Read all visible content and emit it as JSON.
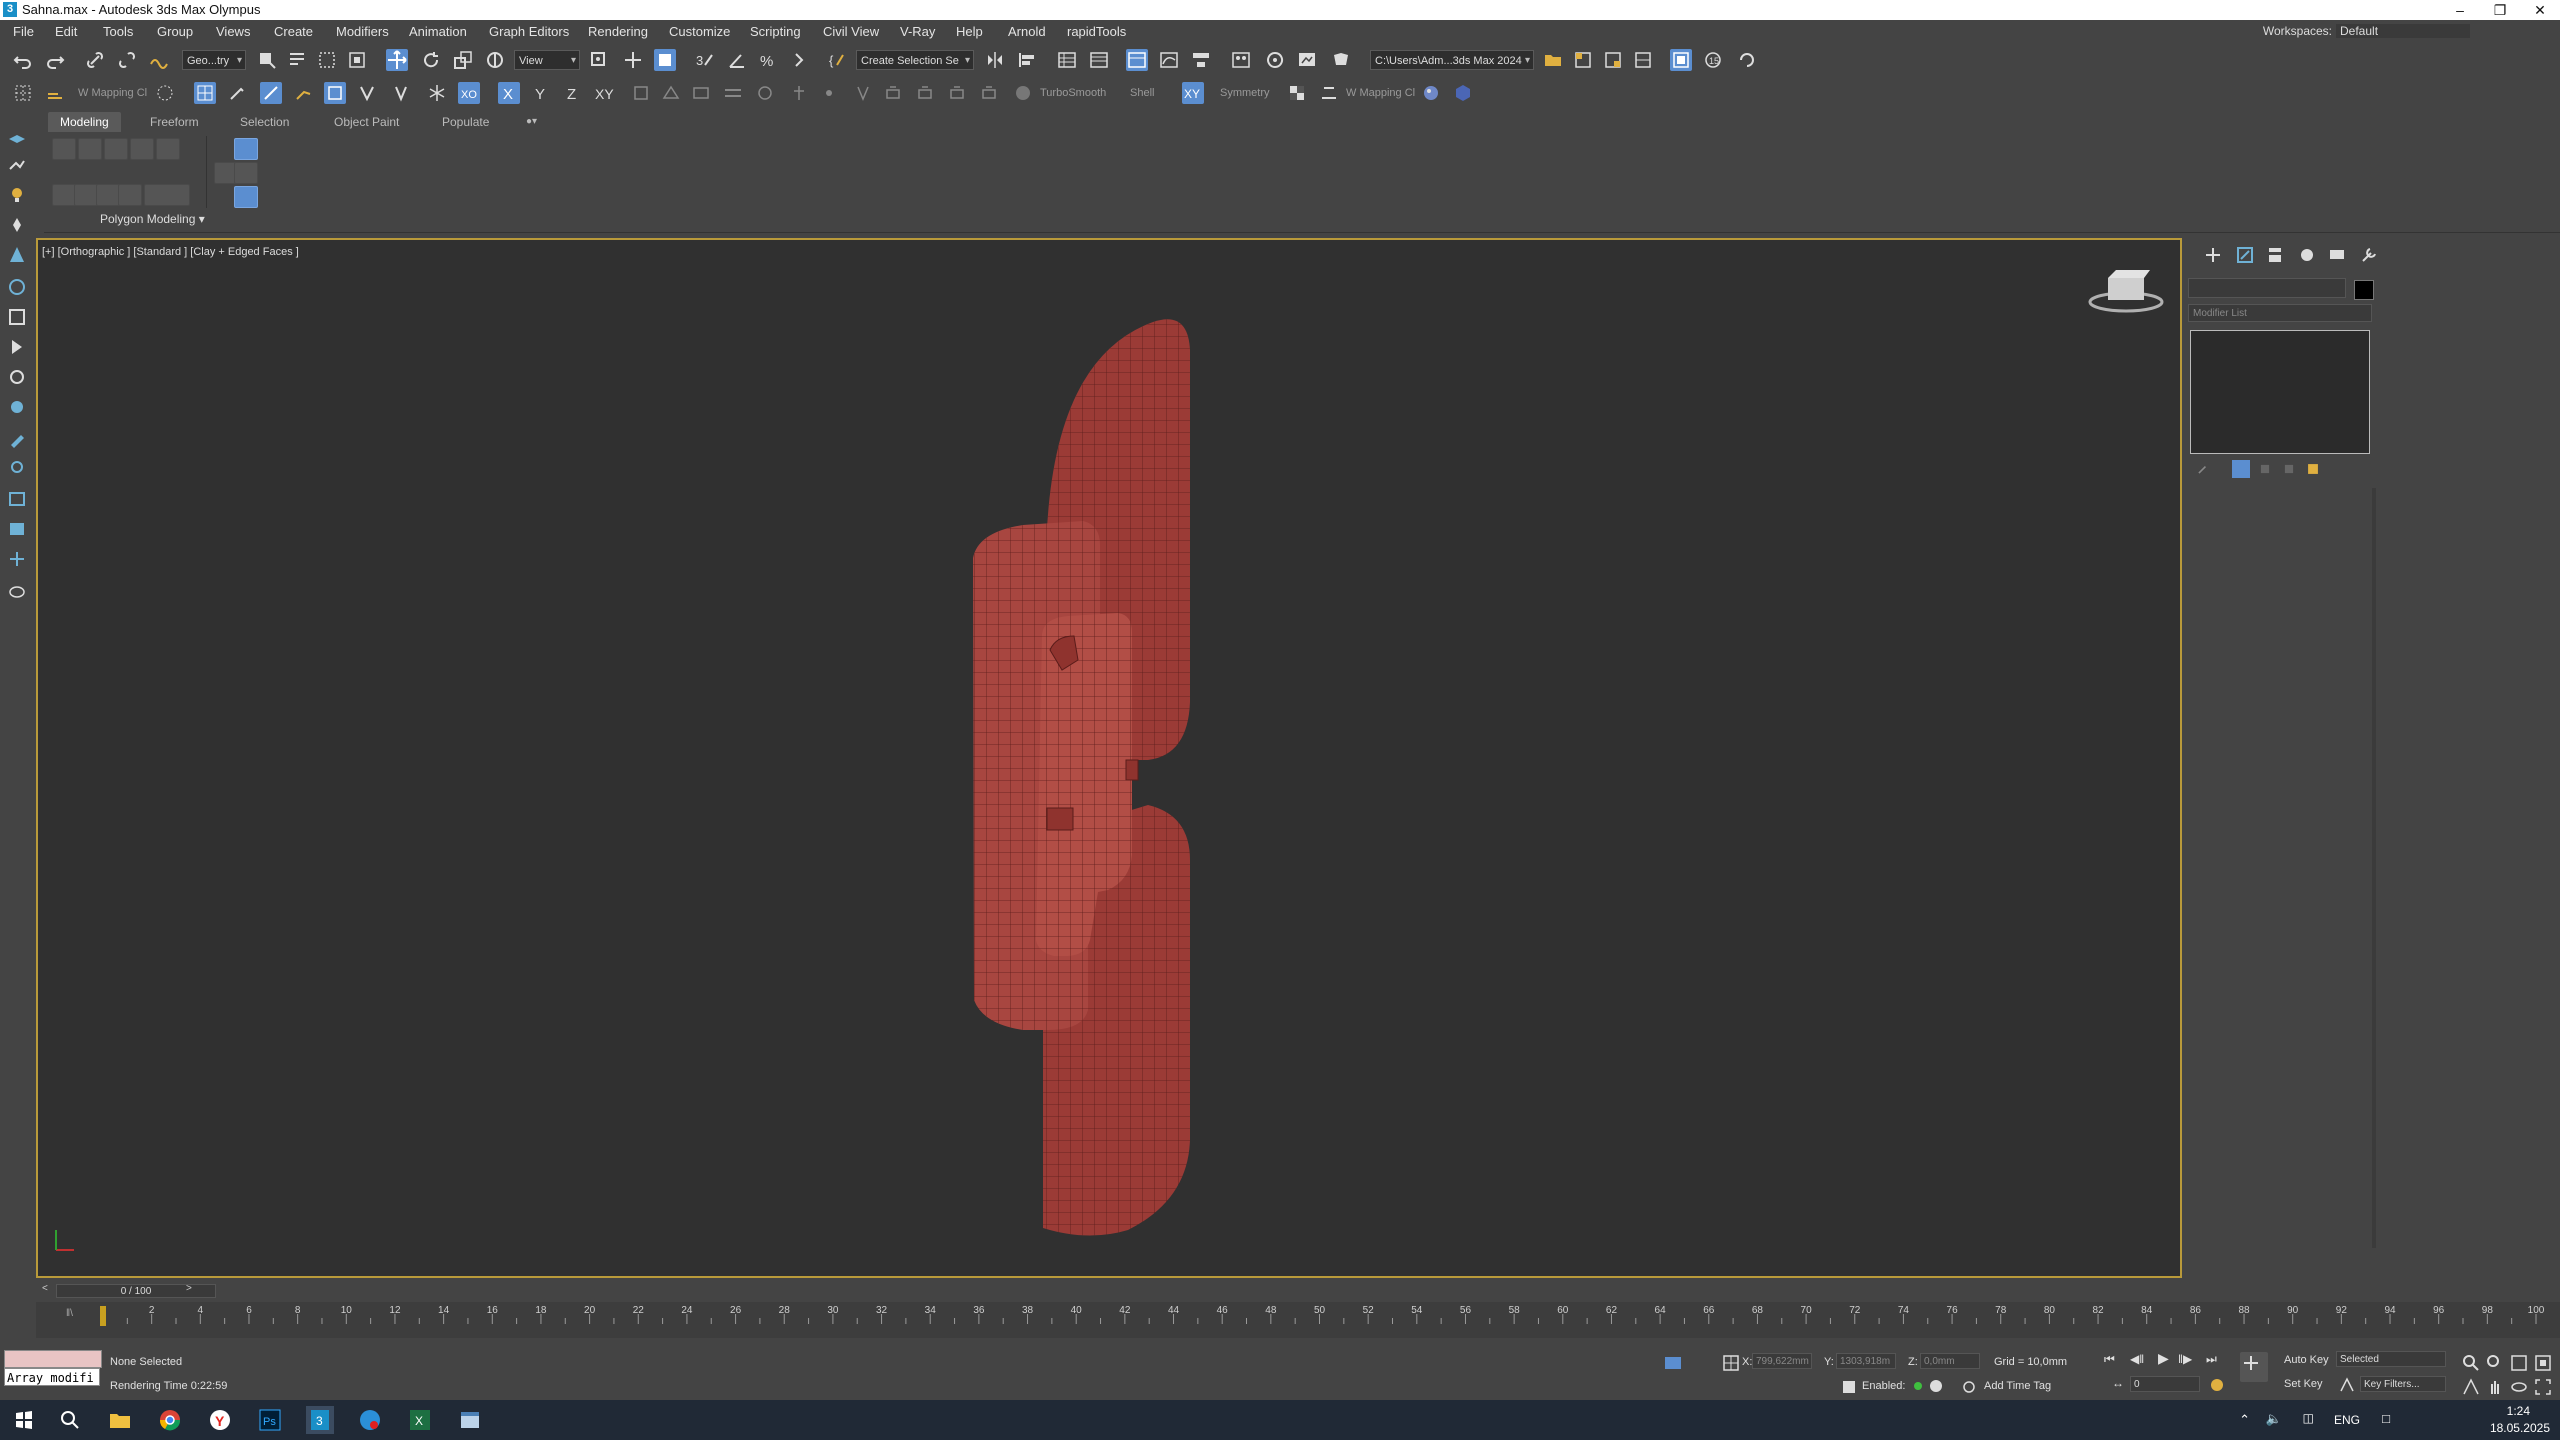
{
  "window": {
    "title": "Sahna.max - Autodesk 3ds Max Olympus",
    "controls": [
      "minimize",
      "restore",
      "close"
    ]
  },
  "menubar": {
    "items": [
      "File",
      "Edit",
      "Tools",
      "Group",
      "Views",
      "Create",
      "Modifiers",
      "Animation",
      "Graph Editors",
      "Rendering",
      "Customize",
      "Scripting",
      "Civil View",
      "V-Ray",
      "Help",
      "Arnold",
      "rapidTools"
    ],
    "workspace_label": "Workspaces:",
    "workspace_value": "Default"
  },
  "toolbar1": {
    "selection_filter": "Geo...try",
    "ref_coord": "View",
    "named_selection": "Create Selection Se",
    "project_path": "C:\\Users\\Adm...3ds Max 2024"
  },
  "toolbar2": {
    "uv_mapping_1": "W Mapping Cl",
    "turbosmooth": "TurboSmooth",
    "shell": "Shell",
    "xyz": [
      "X",
      "Y",
      "Z",
      "XY"
    ],
    "symmetry": "Symmetry",
    "uv_mapping_2": "W Mapping Cl"
  },
  "ribbon": {
    "tabs": [
      "Modeling",
      "Freeform",
      "Selection",
      "Object Paint",
      "Populate"
    ],
    "active_tab": "Modeling",
    "panel_label": "Polygon Modeling"
  },
  "viewport": {
    "label": "[+] [Orthographic ] [Standard ] [Clay + Edged Faces ]",
    "model_color": "#9b3b36",
    "wire_color": "#5a1c1a",
    "border_color": "#b99a3a"
  },
  "command_panel": {
    "modifier_list": "Modifier List"
  },
  "timeline": {
    "slider": "0 / 100",
    "tick_labels": [
      "0",
      "2",
      "4",
      "6",
      "8",
      "10",
      "12",
      "14",
      "16",
      "18",
      "20",
      "22",
      "24",
      "26",
      "28",
      "30",
      "32",
      "34",
      "36",
      "38",
      "40",
      "42",
      "44",
      "46",
      "48",
      "50",
      "52",
      "54",
      "56",
      "58",
      "60",
      "62",
      "64",
      "66",
      "68",
      "70",
      "72",
      "74",
      "76",
      "78",
      "80",
      "82",
      "84",
      "86",
      "88",
      "90",
      "92",
      "94",
      "96",
      "98",
      "100"
    ]
  },
  "status": {
    "maxscript_text": "Array modifi",
    "selection": "None Selected",
    "render_time": "Rendering Time  0:22:59",
    "x_label": "X:",
    "x_value": "799,622mm",
    "y_label": "Y:",
    "y_value": "1303,918m",
    "z_label": "Z:",
    "z_value": "0,0mm",
    "grid": "Grid = 10,0mm",
    "enabled": "Enabled:",
    "add_time_tag": "Add Time Tag",
    "auto_key": "Auto Key",
    "selected": "Selected",
    "set_key": "Set Key",
    "key_filters": "Key Filters...",
    "frame_value": "0"
  },
  "taskbar": {
    "lang": "ENG",
    "time": "1:24",
    "date": "18.05.2025"
  }
}
